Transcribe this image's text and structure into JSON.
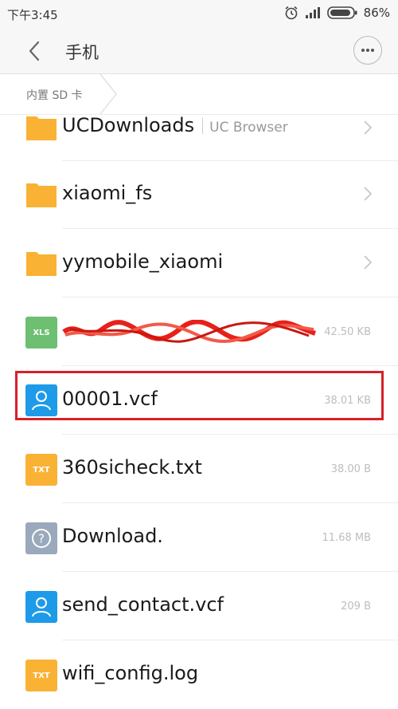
{
  "status_bar": {
    "time": "下午3:45",
    "battery": "86%",
    "icons": [
      "alarm-icon",
      "signal-icon",
      "battery-icon"
    ]
  },
  "header": {
    "title": "手机",
    "back_icon": "chevron-left-icon",
    "more_icon": "more-icon"
  },
  "breadcrumb": {
    "items": [
      "内置 SD 卡"
    ]
  },
  "colors": {
    "folder": "#f9b234",
    "xls": "#6dbf72",
    "contact": "#1e9be8",
    "txt": "#f9b234",
    "unknown": "#9aa9bb",
    "highlight": "#d8202a"
  },
  "files": [
    {
      "name": "UCDownloads",
      "sub": "UC Browser",
      "type": "folder",
      "meta": ""
    },
    {
      "name": "xiaomi_fs",
      "sub": "",
      "type": "folder",
      "meta": ""
    },
    {
      "name": "yymobile_xiaomi",
      "sub": "",
      "type": "folder",
      "meta": ""
    },
    {
      "name": "",
      "sub": "",
      "type": "xls",
      "icon_label": "XLS",
      "meta": "42.50 KB",
      "redacted": true
    },
    {
      "name": "00001.vcf",
      "sub": "",
      "type": "contact",
      "meta": "38.01 KB"
    },
    {
      "name": "360sicheck.txt",
      "sub": "",
      "type": "txt",
      "icon_label": "TXT",
      "meta": "38.00 B"
    },
    {
      "name": "Download.",
      "sub": "",
      "type": "unknown",
      "meta": "11.68 MB"
    },
    {
      "name": "send_contact.vcf",
      "sub": "",
      "type": "contact",
      "meta": "209 B"
    },
    {
      "name": "wifi_config.log",
      "sub": "",
      "type": "txt",
      "icon_label": "TXT",
      "meta": ""
    }
  ]
}
